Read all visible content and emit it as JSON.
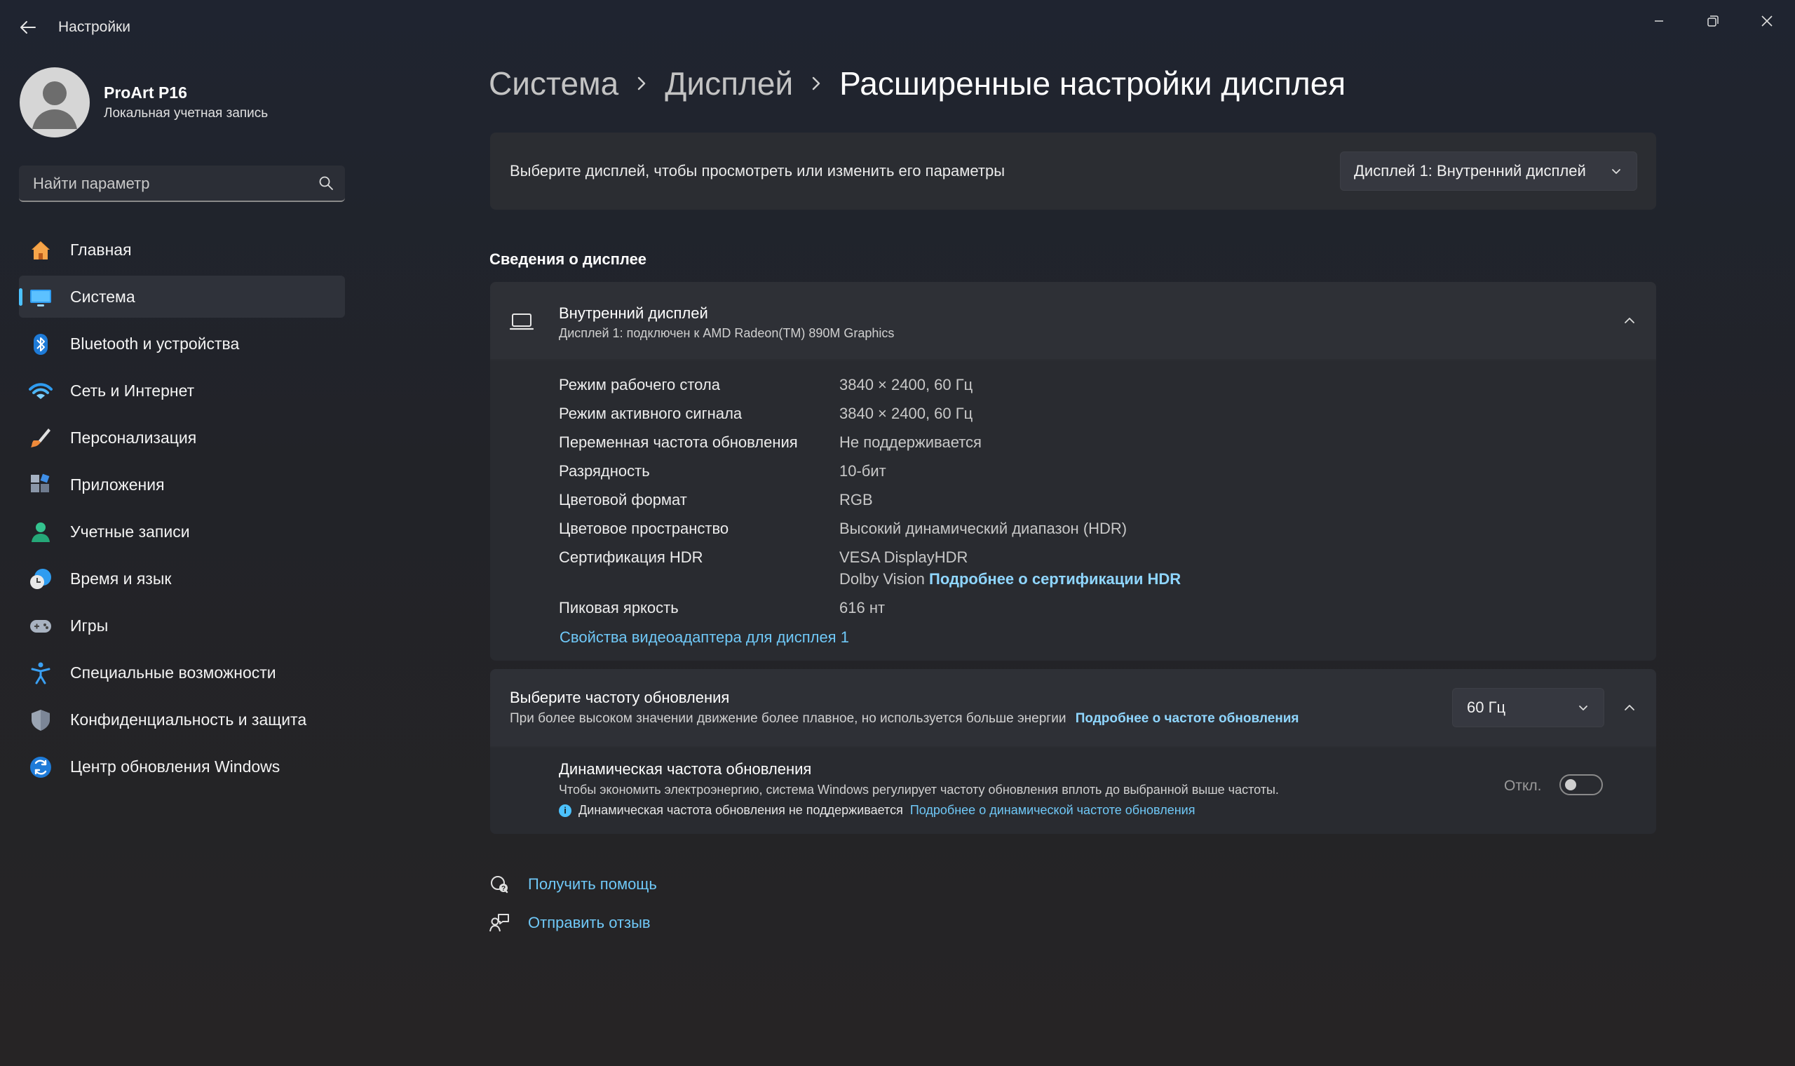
{
  "window": {
    "title": "Настройки"
  },
  "profile": {
    "name": "ProArt P16",
    "account_type": "Локальная учетная запись"
  },
  "search": {
    "placeholder": "Найти параметр"
  },
  "sidebar": {
    "items": [
      {
        "label": "Главная",
        "icon": "home-icon",
        "active": false
      },
      {
        "label": "Система",
        "icon": "system-icon",
        "active": true
      },
      {
        "label": "Bluetooth и устройства",
        "icon": "bluetooth-icon",
        "active": false
      },
      {
        "label": "Сеть и Интернет",
        "icon": "network-icon",
        "active": false
      },
      {
        "label": "Персонализация",
        "icon": "brush-icon",
        "active": false
      },
      {
        "label": "Приложения",
        "icon": "apps-icon",
        "active": false
      },
      {
        "label": "Учетные записи",
        "icon": "accounts-icon",
        "active": false
      },
      {
        "label": "Время и язык",
        "icon": "time-language-icon",
        "active": false
      },
      {
        "label": "Игры",
        "icon": "gaming-icon",
        "active": false
      },
      {
        "label": "Специальные возможности",
        "icon": "accessibility-icon",
        "active": false
      },
      {
        "label": "Конфиденциальность и защита",
        "icon": "shield-icon",
        "active": false
      },
      {
        "label": "Центр обновления Windows",
        "icon": "windows-update-icon",
        "active": false
      }
    ]
  },
  "breadcrumb": {
    "items": [
      "Система",
      "Дисплей"
    ],
    "current": "Расширенные настройки дисплея"
  },
  "display_select": {
    "prompt": "Выберите дисплей, чтобы просмотреть или изменить его параметры",
    "selected": "Дисплей 1: Внутренний дисплей"
  },
  "display_info": {
    "section_title": "Сведения о дисплее",
    "title": "Внутренний дисплей",
    "subtitle": "Дисплей 1: подключен к AMD Radeon(TM) 890M Graphics",
    "rows": [
      {
        "label": "Режим рабочего стола",
        "value": "3840 × 2400, 60 Гц"
      },
      {
        "label": "Режим активного сигнала",
        "value": "3840 × 2400, 60 Гц"
      },
      {
        "label": "Переменная частота обновления",
        "value": "Не поддерживается"
      },
      {
        "label": "Разрядность",
        "value": "10-бит"
      },
      {
        "label": "Цветовой формат",
        "value": "RGB"
      },
      {
        "label": "Цветовое пространство",
        "value": "Высокий динамический диапазон (HDR)"
      }
    ],
    "hdr_label": "Сертификация HDR",
    "hdr_value_1": "VESA DisplayHDR",
    "hdr_value_2": "Dolby Vision",
    "hdr_link": "Подробнее о сертификации HDR",
    "peak_label": "Пиковая яркость",
    "peak_value": "616 нт",
    "adapter_link": "Свойства видеоадаптера для дисплея 1"
  },
  "refresh": {
    "title": "Выберите частоту обновления",
    "description": "При более высоком значении движение более плавное, но используется больше энергии",
    "link": "Подробнее о частоте обновления",
    "selected": "60 Гц",
    "dynamic_title": "Динамическая частота обновления",
    "dynamic_description": "Чтобы экономить электроэнергию, система Windows регулирует частоту обновления вплоть до выбранной выше частоты.",
    "dynamic_note": "Динамическая частота обновления не поддерживается",
    "dynamic_link": "Подробнее о динамической частоте обновления",
    "toggle_label": "Откл.",
    "toggle_on": false
  },
  "footer": {
    "help": "Получить помощь",
    "feedback": "Отправить отзыв"
  },
  "colors": {
    "accent": "#4cc2ff",
    "link": "#6fc8f7"
  }
}
